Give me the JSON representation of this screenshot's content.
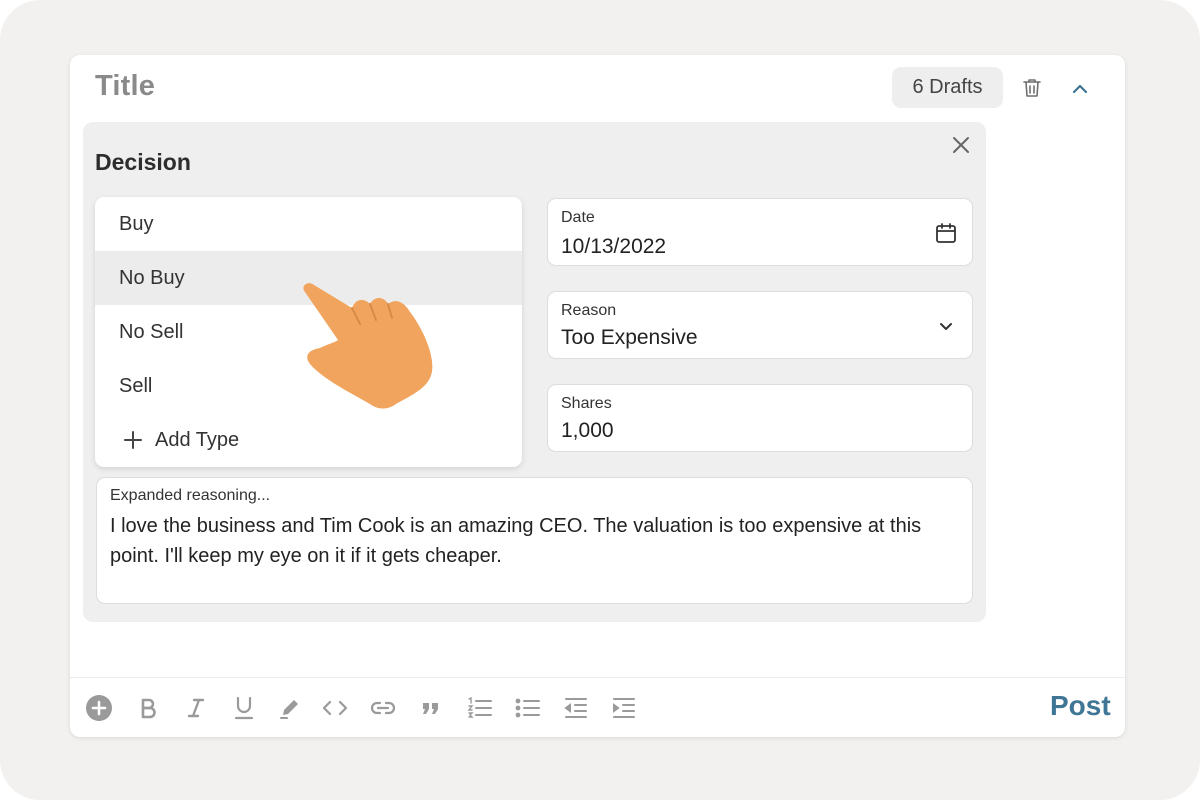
{
  "editor": {
    "title_placeholder": "Title",
    "drafts_label": "6 Drafts",
    "post_label": "Post"
  },
  "decision": {
    "heading": "Decision",
    "types": [
      {
        "label": "Buy",
        "active": false
      },
      {
        "label": "No Buy",
        "active": true
      },
      {
        "label": "No Sell",
        "active": false
      },
      {
        "label": "Sell",
        "active": false
      }
    ],
    "add_type_label": "Add Type",
    "date": {
      "label": "Date",
      "value": "10/13/2022"
    },
    "reason": {
      "label": "Reason",
      "value": "Too Expensive"
    },
    "shares": {
      "label": "Shares",
      "value": "1,000"
    },
    "reasoning": {
      "label": "Expanded reasoning...",
      "value": "I love the business and Tim Cook is an amazing CEO. The valuation is too expensive at this point. I'll keep my eye on it if it gets cheaper."
    }
  },
  "toolbar": {
    "icons": [
      "add-circle-icon",
      "bold-icon",
      "italic-icon",
      "underline-icon",
      "highlight-pen-icon",
      "code-icon",
      "link-icon",
      "quote-icon",
      "numbered-list-icon",
      "bulleted-list-icon",
      "outdent-icon",
      "indent-icon"
    ]
  },
  "colors": {
    "accent": "#3f7595",
    "hand": "#f0a45e",
    "panel_bg": "#efefef",
    "active_item_bg": "#ececec"
  }
}
